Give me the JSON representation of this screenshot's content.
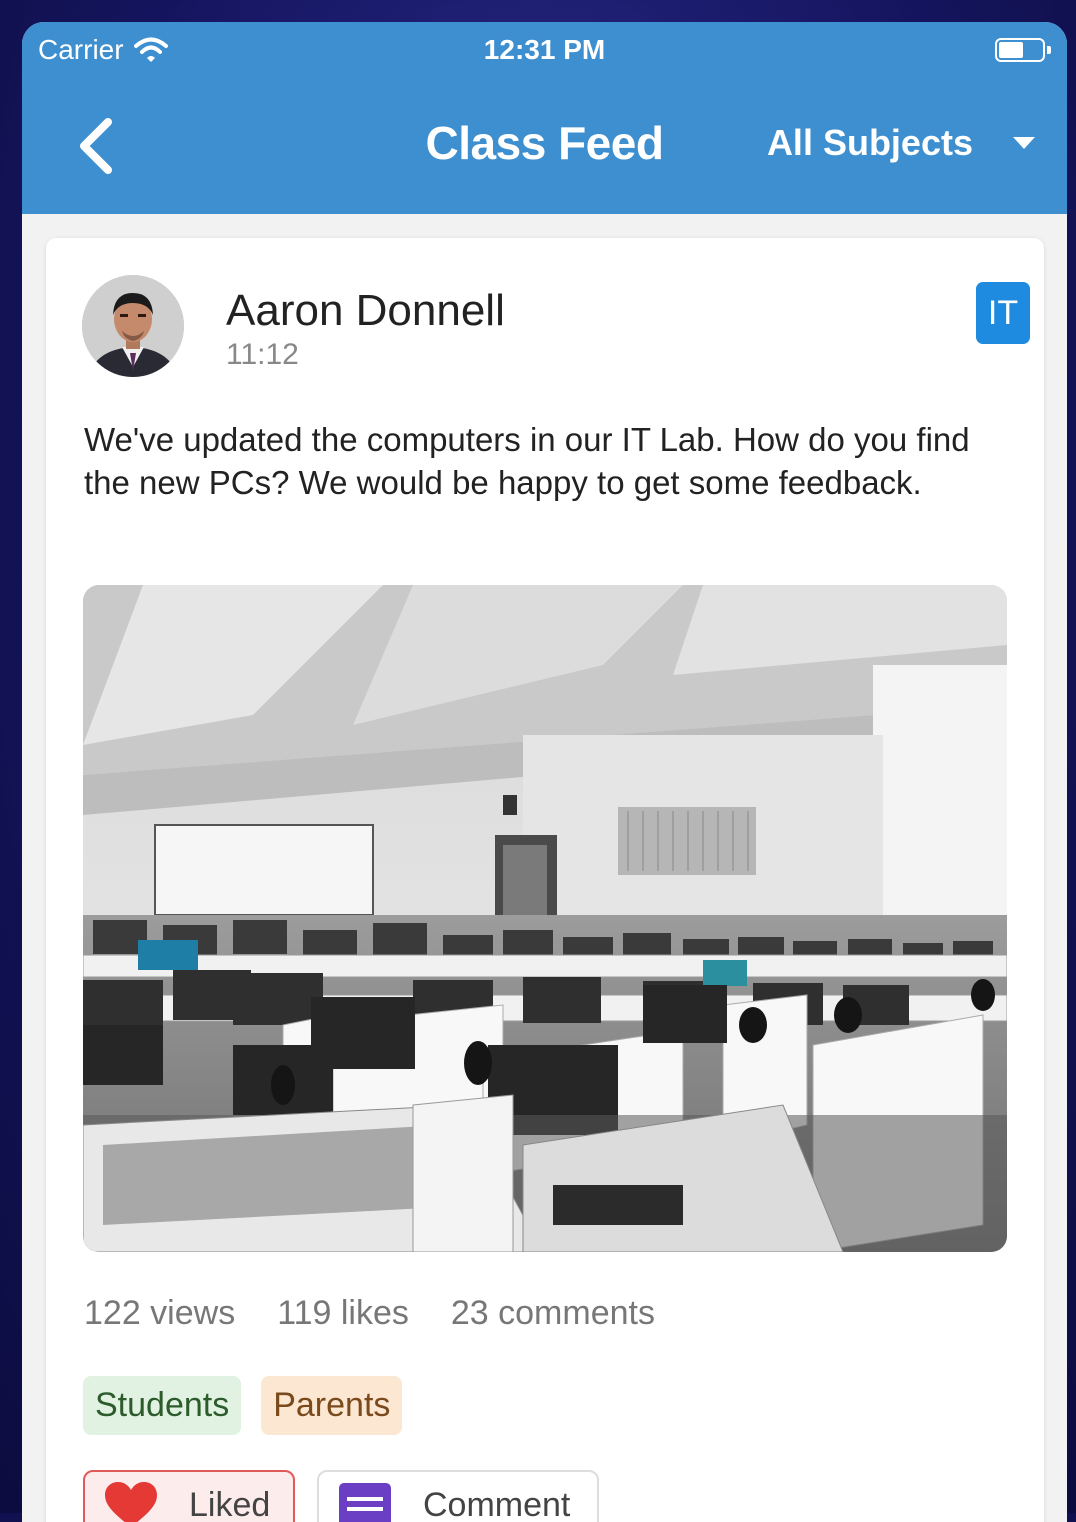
{
  "status_bar": {
    "carrier": "Carrier",
    "time": "12:31 PM"
  },
  "navbar": {
    "title": "Class Feed",
    "subject_filter": "All Subjects"
  },
  "post": {
    "author": "Aaron Donnell",
    "time": "11:12",
    "subject_badge": "IT",
    "text": "We've updated the computers in our IT Lab. How do you find the new PCs? We would be happy to get some feedback.",
    "stats": {
      "views": "122 views",
      "likes": "119 likes",
      "comments": "23 comments"
    },
    "audience_tags": [
      "Students",
      "Parents"
    ],
    "actions": {
      "like_label": "Liked",
      "comment_label": "Comment"
    }
  },
  "colors": {
    "header": "#3d8fd0",
    "badge": "#1f8be0",
    "students_tag": "#e2f2e2",
    "parents_tag": "#fbe7d2",
    "liked_border": "#e05a5a",
    "comment_icon": "#6a3fc4"
  },
  "icons": [
    "wifi-icon",
    "battery-icon",
    "back-chevron-icon",
    "dropdown-caret-icon",
    "heart-icon",
    "comment-icon"
  ]
}
